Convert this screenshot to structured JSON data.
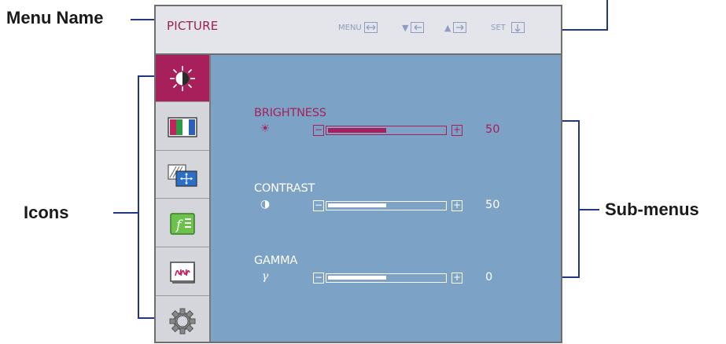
{
  "callouts": {
    "menu_name": "Menu Name",
    "icons": "Icons",
    "sub_menus": "Sub-menus"
  },
  "osd": {
    "menu_name": "PICTURE",
    "hotkeys": [
      {
        "label": "MENU",
        "symbol": "",
        "icon": "exit-arrows-icon"
      },
      {
        "label": "",
        "symbol": "▼",
        "icon": "left-arrow-icon"
      },
      {
        "label": "",
        "symbol": "▲",
        "icon": "right-arrow-icon"
      },
      {
        "label": "SET",
        "symbol": "",
        "icon": "down-arrow-icon"
      }
    ],
    "icons": [
      {
        "name": "brightness-icon",
        "selected": true
      },
      {
        "name": "color-bars-icon",
        "selected": false
      },
      {
        "name": "position-icon",
        "selected": false
      },
      {
        "name": "function-icon",
        "selected": false
      },
      {
        "name": "signal-icon",
        "selected": false
      },
      {
        "name": "settings-gear-icon",
        "selected": false
      }
    ],
    "submenus": [
      {
        "label": "BRIGHTNESS",
        "symbol": "☀",
        "minus": "−",
        "plus": "+",
        "value": "50",
        "level": 0.5,
        "active": true
      },
      {
        "label": "CONTRAST",
        "symbol": "◑",
        "minus": "−",
        "plus": "+",
        "value": "50",
        "level": 0.5,
        "active": false
      },
      {
        "label": "GAMMA",
        "symbol": "γ",
        "minus": "−",
        "plus": "+",
        "value": "0",
        "level": 0.5,
        "active": false
      }
    ]
  },
  "colors": {
    "accent": "#a8205b",
    "panel": "#7ca2c5",
    "leader": "#23367f"
  }
}
